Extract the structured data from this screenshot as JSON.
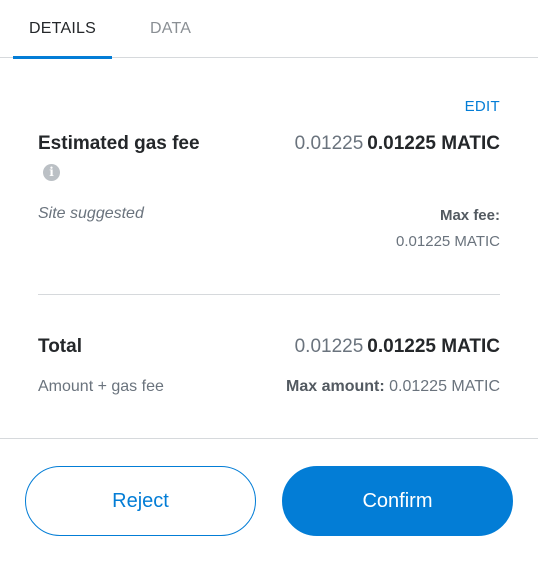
{
  "tabs": {
    "details": "DETAILS",
    "data": "DATA"
  },
  "edit_label": "EDIT",
  "gas_fee": {
    "label": "Estimated gas fee",
    "info_icon": "info-icon",
    "amount_secondary": "0.01225",
    "amount_primary": "0.01225 MATIC",
    "site_suggested": "Site suggested",
    "max_fee_label": "Max fee:",
    "max_fee_value": "0.01225 MATIC"
  },
  "total": {
    "label": "Total",
    "amount_secondary": "0.01225",
    "amount_primary": "0.01225 MATIC",
    "sub_label": "Amount + gas fee",
    "max_amount_label": "Max amount:",
    "max_amount_value": "0.01225 MATIC"
  },
  "buttons": {
    "reject": "Reject",
    "confirm": "Confirm"
  },
  "colors": {
    "accent": "#037dd6",
    "text": "#24272a",
    "muted": "#6a737d"
  }
}
